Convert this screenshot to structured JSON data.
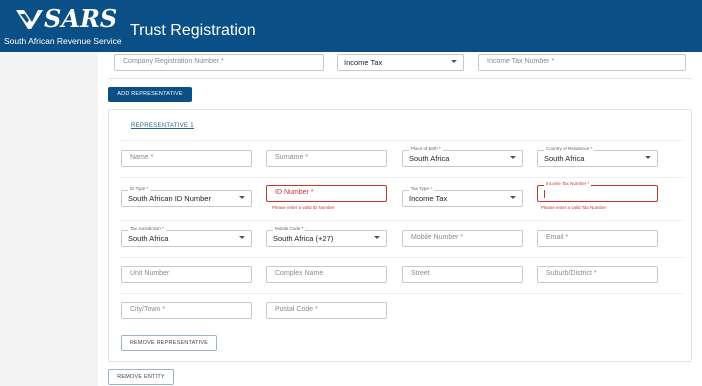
{
  "header": {
    "logo_text": "SARS",
    "org_name": "South African Revenue Service",
    "title": "Trust Registration",
    "brand_color": "#0a4f86"
  },
  "top_row": {
    "company_reg_placeholder": "Company Registration Number *",
    "tax_type_value": "Income Tax",
    "income_tax_placeholder": "Income Tax Number *"
  },
  "add_representative_label": "ADD REPRESENTATIVE",
  "representative": {
    "heading": "REPRESENTATIVE 1",
    "name_placeholder": "Name *",
    "surname_placeholder": "Surname *",
    "place_of_birth_label": "Place of Birth *",
    "place_of_birth_value": "South Africa",
    "country_residence_label": "Country of Residence *",
    "country_residence_value": "South Africa",
    "id_type_label": "ID Type *",
    "id_type_value": "South African ID Number",
    "id_number_placeholder": "ID Number *",
    "id_number_error": "Please enter a valid ID Number",
    "tax_type_label": "Tax Type *",
    "tax_type_value": "Income Tax",
    "income_tax_label": "Income Tax Number *",
    "income_tax_error": "Please enter a valid Tax Number",
    "tax_jurisdiction_label": "Tax Jurisdiction *",
    "tax_jurisdiction_value": "South Africa",
    "mobile_code_label": "Mobile Code *",
    "mobile_code_value": "South Africa (+27)",
    "mobile_number_placeholder": "Mobile Number *",
    "email_placeholder": "Email *",
    "unit_number_placeholder": "Unit Number",
    "complex_name_placeholder": "Complex Name",
    "street_placeholder": "Street",
    "suburb_placeholder": "Suburb/District *",
    "city_placeholder": "City/Town *",
    "postal_code_placeholder": "Postal Code *",
    "remove_representative_label": "REMOVE REPRESENTATIVE"
  },
  "remove_entity_label": "REMOVE ENTITY",
  "error_color": "#c0392b"
}
